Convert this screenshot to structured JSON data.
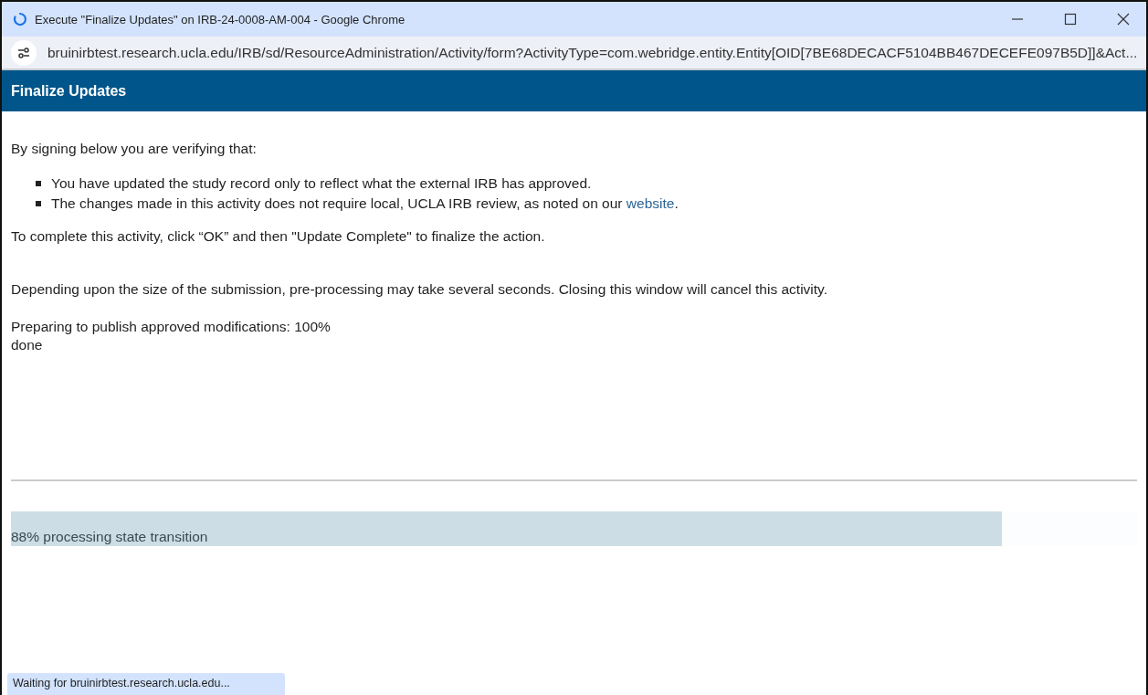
{
  "window": {
    "title": "Execute \"Finalize Updates\" on IRB-24-0008-AM-004 - Google Chrome",
    "loading": true
  },
  "address_bar": {
    "url": "bruinirbtest.research.ucla.edu/IRB/sd/ResourceAdministration/Activity/form?ActivityType=com.webridge.entity.Entity[OID[7BE68DECACF5104BB467DECEFE097B5D]]&Act..."
  },
  "header": {
    "title": "Finalize Updates"
  },
  "intro": "By signing below you are verifying that:",
  "bullets": [
    {
      "text": "You have updated the study record only to reflect what the external IRB has approved."
    },
    {
      "text": "The changes made in this activity does not require local, UCLA IRB review, as noted on our ",
      "link": "website",
      "after": "."
    }
  ],
  "instruction": "To complete this activity, click “OK” and then \"Update Complete\" to finalize the action.",
  "warning": "Depending upon the size of the submission, pre-processing may take several seconds. Closing this window will cancel this activity.",
  "status_lines": [
    "Preparing to publish approved modifications: 100%",
    "done"
  ],
  "progress": {
    "level": 0.88,
    "label": "88% processing state transition"
  },
  "status_bubble": "Waiting for bruinirbtest.research.ucla.edu..."
}
